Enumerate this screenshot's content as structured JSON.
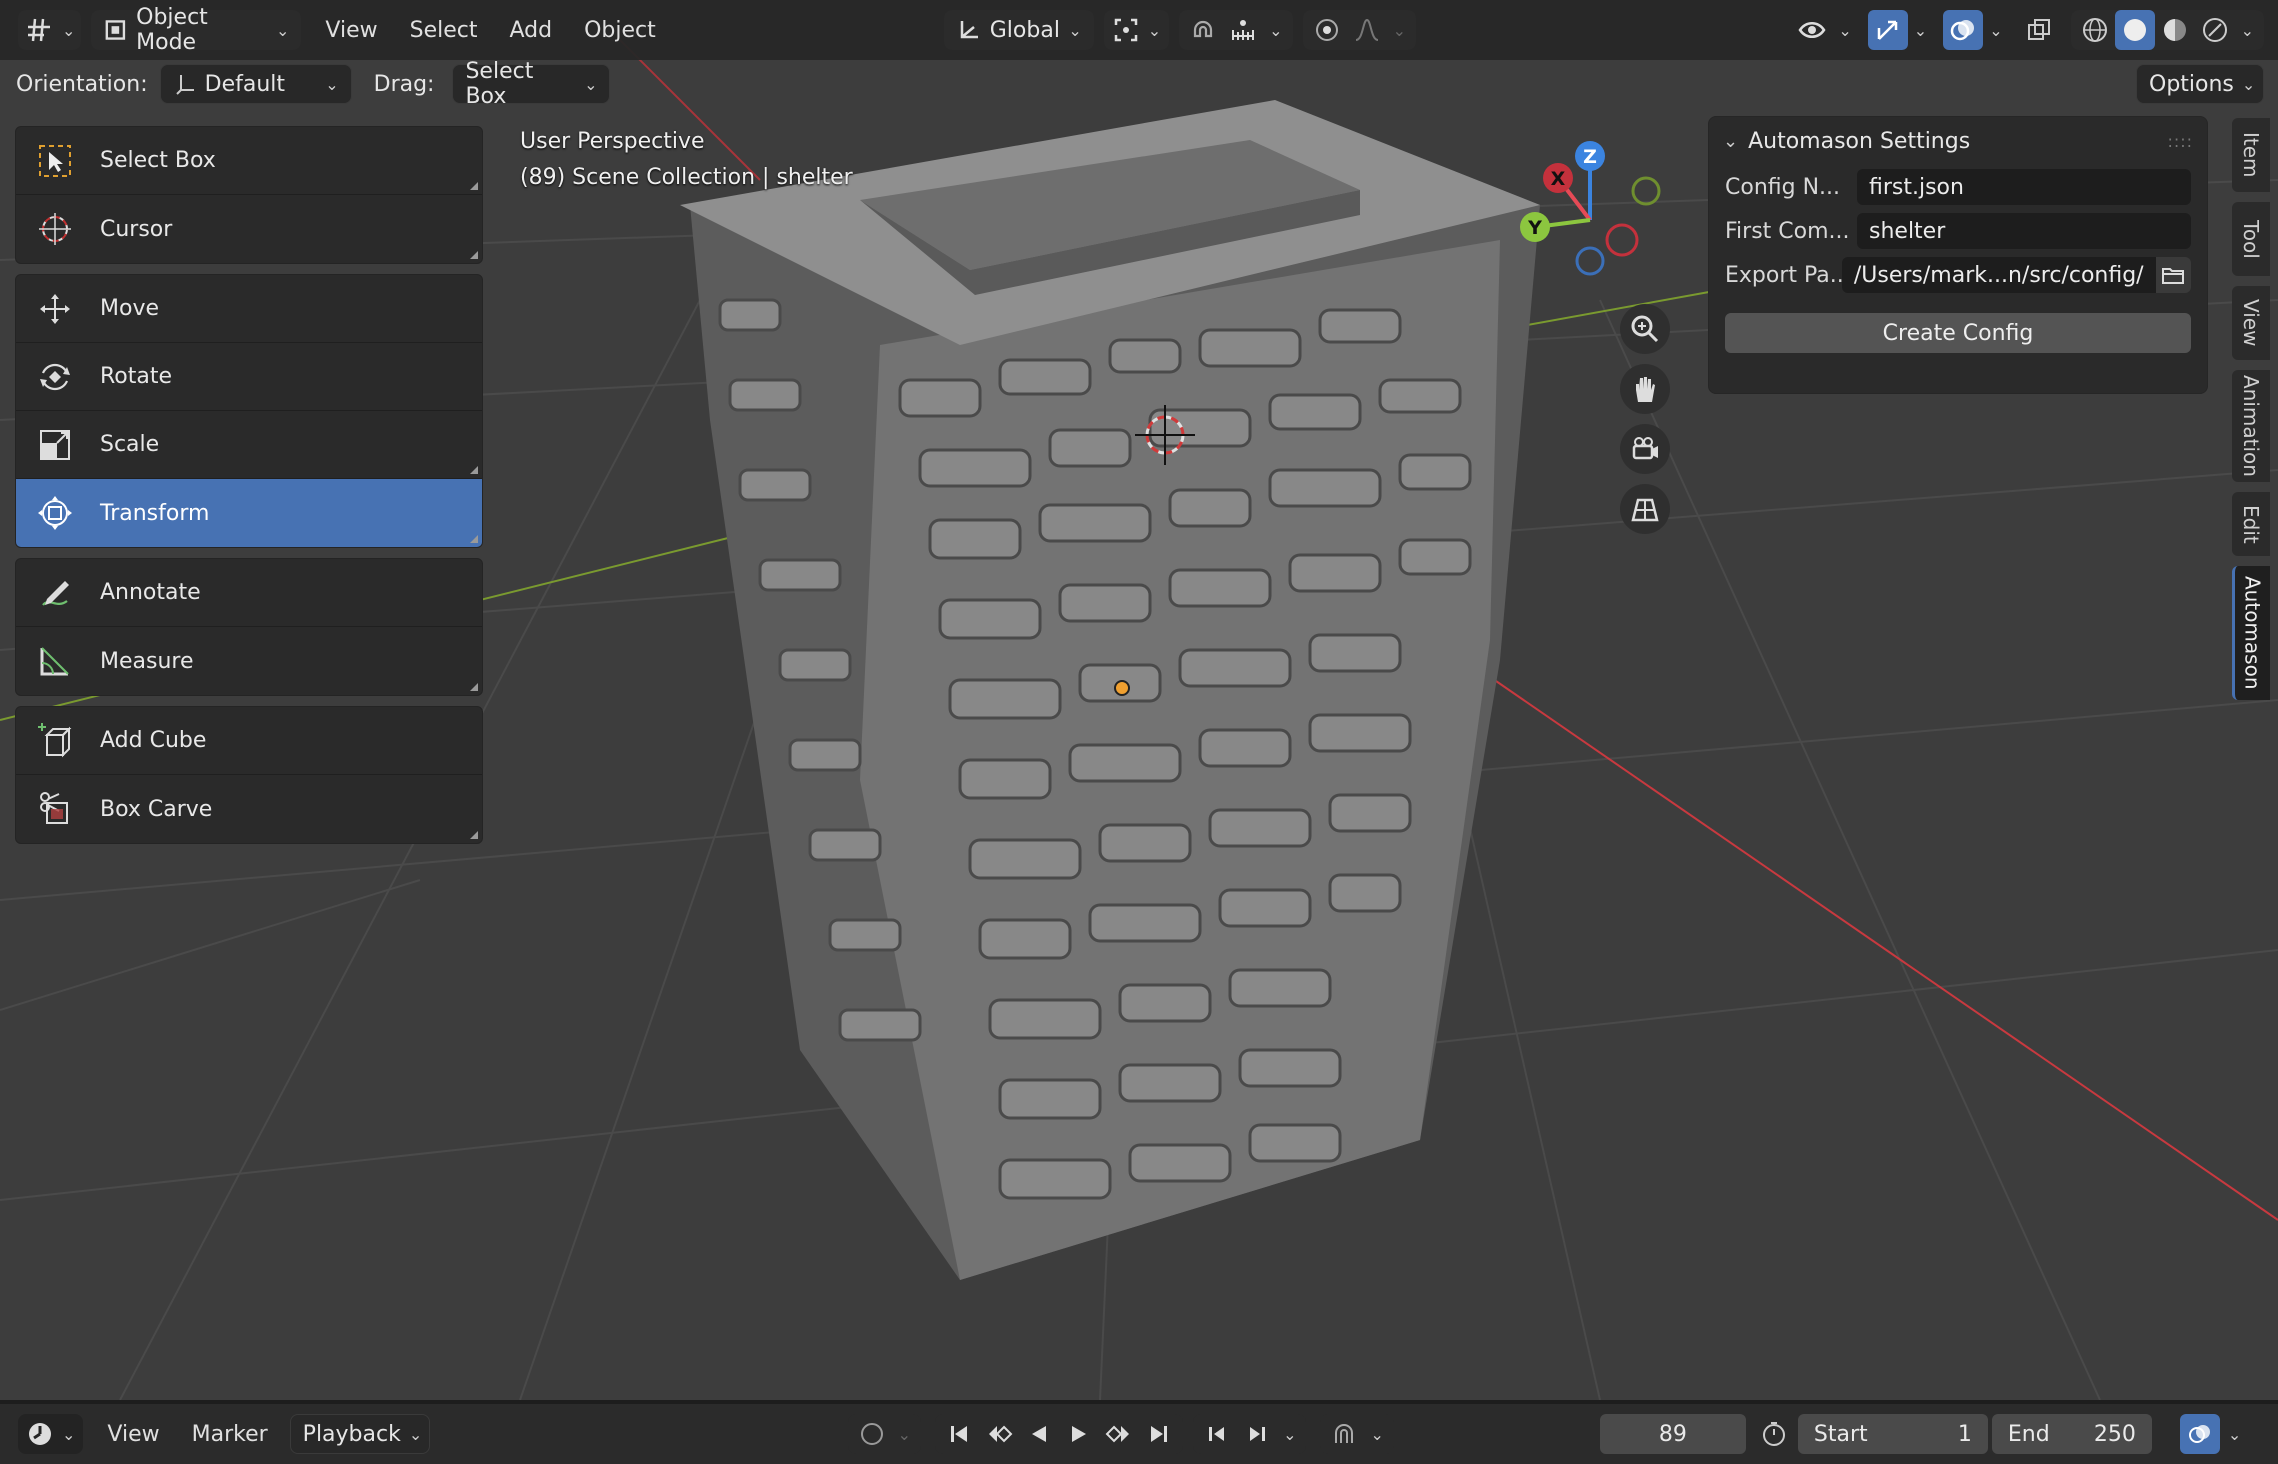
{
  "header": {
    "mode": "Object Mode",
    "menus": [
      "View",
      "Select",
      "Add",
      "Object"
    ],
    "transform_space": "Global"
  },
  "tool_settings": {
    "orientation_label": "Orientation:",
    "orientation_value": "Default",
    "drag_label": "Drag:",
    "drag_value": "Select Box",
    "options_label": "Options"
  },
  "toolbar": {
    "groups": [
      [
        {
          "label": "Select Box",
          "icon": "select-box-icon"
        },
        {
          "label": "Cursor",
          "icon": "cursor-icon"
        }
      ],
      [
        {
          "label": "Move",
          "icon": "move-icon"
        },
        {
          "label": "Rotate",
          "icon": "rotate-icon"
        },
        {
          "label": "Scale",
          "icon": "scale-icon"
        },
        {
          "label": "Transform",
          "icon": "transform-icon",
          "active": true
        }
      ],
      [
        {
          "label": "Annotate",
          "icon": "annotate-icon"
        },
        {
          "label": "Measure",
          "icon": "measure-icon"
        }
      ],
      [
        {
          "label": "Add Cube",
          "icon": "add-cube-icon"
        },
        {
          "label": "Box Carve",
          "icon": "box-carve-icon"
        }
      ]
    ]
  },
  "viewport": {
    "view_name": "User Perspective",
    "scene_info": "(89) Scene Collection | shelter"
  },
  "gizmo": {
    "x": "X",
    "y": "Y",
    "z": "Z"
  },
  "npanel": {
    "title": "Automason Settings",
    "fields": [
      {
        "label": "Config N...",
        "value": "first.json"
      },
      {
        "label": "First Com...",
        "value": "shelter"
      },
      {
        "label": "Export Pa...",
        "value": "/Users/mark...n/src/config/"
      }
    ],
    "button": "Create Config",
    "tabs": [
      "Item",
      "Tool",
      "View",
      "Animation",
      "Edit",
      "Automason"
    ],
    "active_tab": "Automason"
  },
  "timeline": {
    "menus": [
      "View",
      "Marker"
    ],
    "playback": "Playback",
    "current_frame": "89",
    "start_label": "Start",
    "start_value": "1",
    "end_label": "End",
    "end_value": "250"
  },
  "colors": {
    "accent": "#4772b3",
    "axis_x": "#e64a56",
    "axis_y": "#8cc63f",
    "axis_z": "#3b84e0",
    "stone": "#8f8f8f"
  }
}
